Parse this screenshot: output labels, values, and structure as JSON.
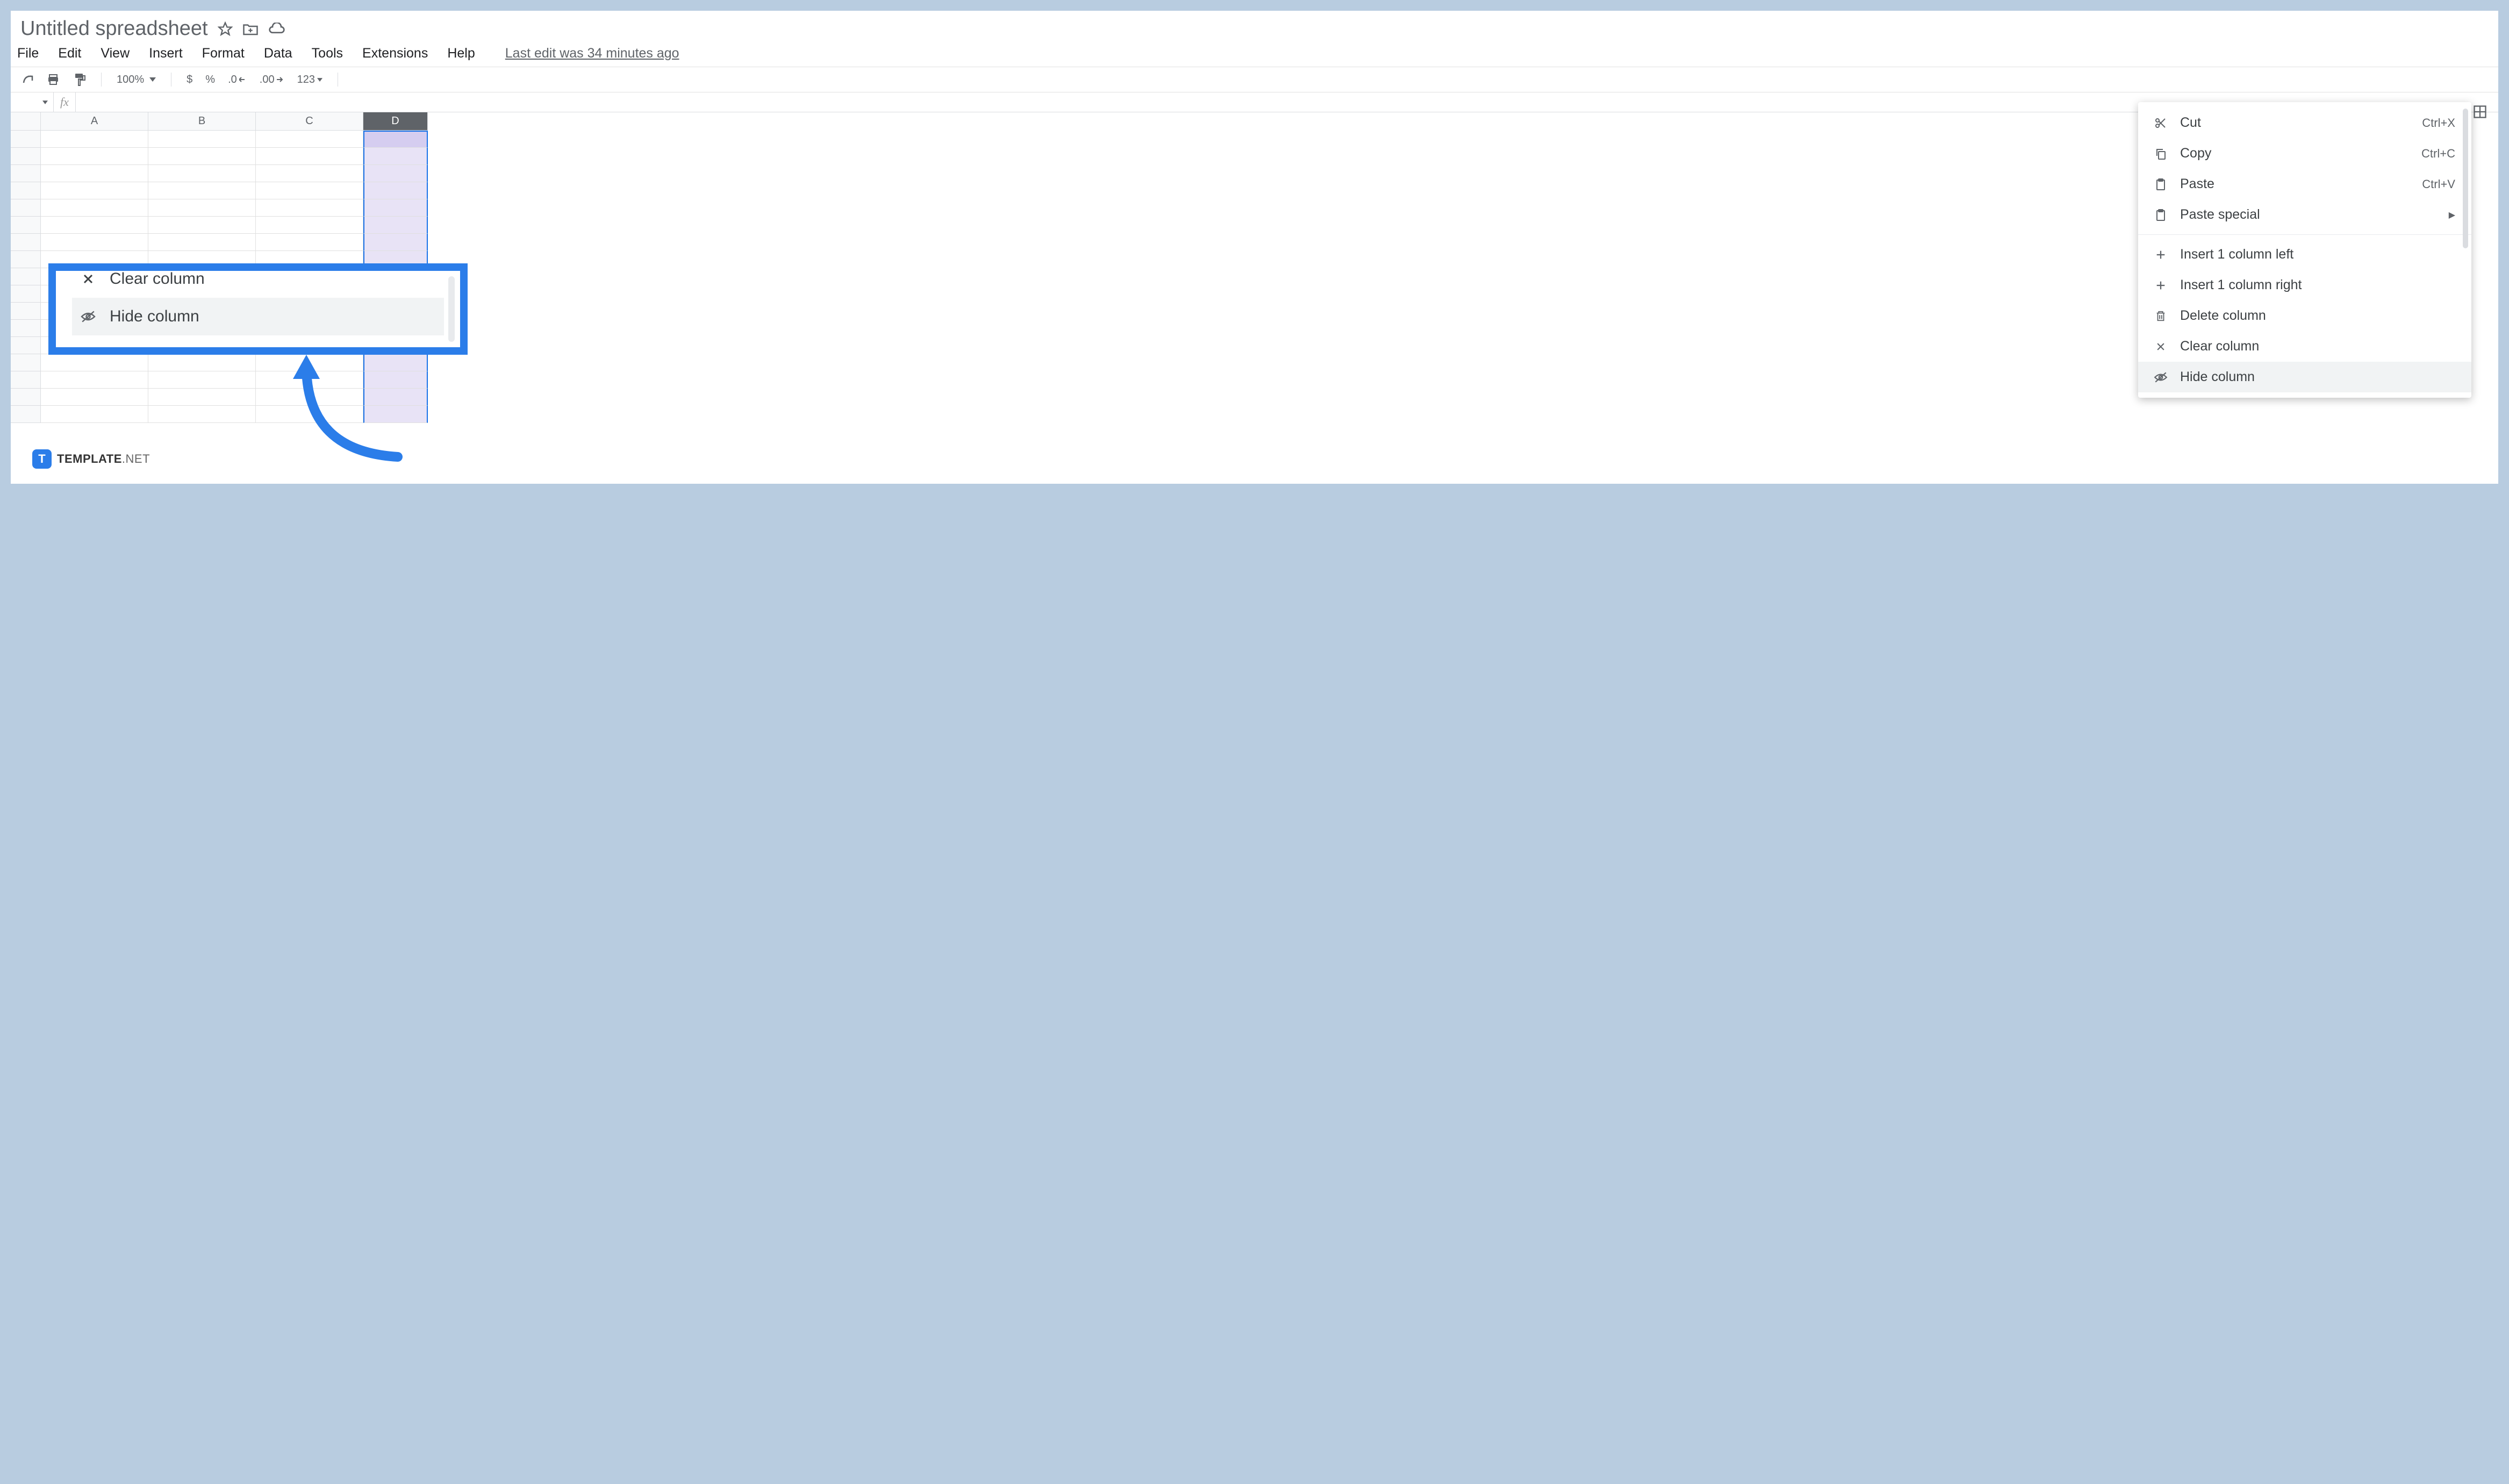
{
  "title": "Untitled spreadsheet",
  "menu": {
    "file": "File",
    "edit": "Edit",
    "view": "View",
    "insert": "Insert",
    "format": "Format",
    "data": "Data",
    "tools": "Tools",
    "extensions": "Extensions",
    "help": "Help",
    "last_edit": "Last edit was 34 minutes ago"
  },
  "toolbar": {
    "zoom": "100%",
    "currency": "$",
    "percent": "%",
    "decrease_dec": ".0",
    "increase_dec": ".00",
    "more_formats": "123"
  },
  "columns": [
    "A",
    "B",
    "C",
    "D"
  ],
  "selected_column": "D",
  "context_menu": {
    "cut": "Cut",
    "cut_sc": "Ctrl+X",
    "copy": "Copy",
    "copy_sc": "Ctrl+C",
    "paste": "Paste",
    "paste_sc": "Ctrl+V",
    "paste_special": "Paste special",
    "insert_left": "Insert 1 column left",
    "insert_right": "Insert 1 column right",
    "delete_col": "Delete column",
    "clear_col": "Clear column",
    "hide_col": "Hide column"
  },
  "callout": {
    "clear_col": "Clear column",
    "hide_col": "Hide column"
  },
  "badge": {
    "brand": "TEMPLATE",
    "tld": ".NET"
  }
}
